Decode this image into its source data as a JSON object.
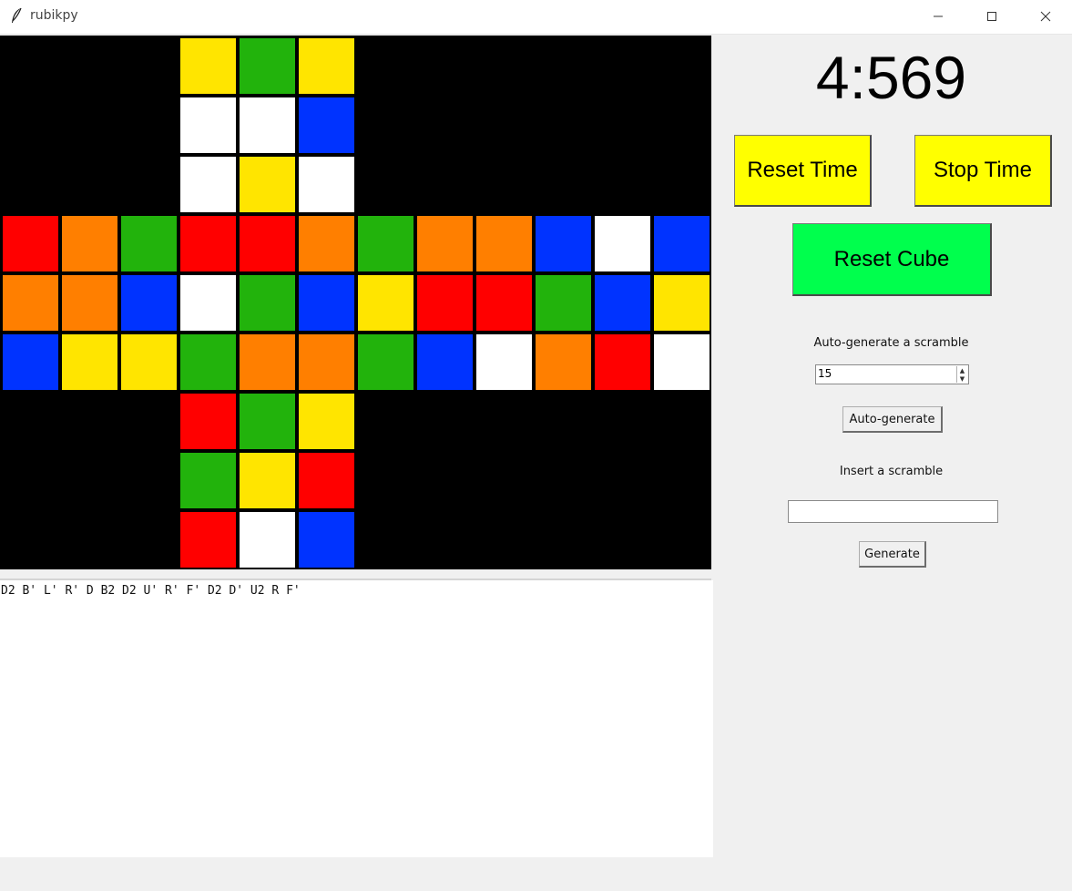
{
  "window": {
    "title": "rubikpy"
  },
  "colors": {
    "W": "#ffffff",
    "Y": "#ffe500",
    "G": "#22b30c",
    "B": "#0033ff",
    "R": "#ff0000",
    "O": "#ff7f00"
  },
  "cube": {
    "up": [
      [
        "Y",
        "G",
        "Y"
      ],
      [
        "W",
        "W",
        "B"
      ],
      [
        "W",
        "Y",
        "W"
      ]
    ],
    "left": [
      [
        "R",
        "O",
        "G"
      ],
      [
        "O",
        "O",
        "B"
      ],
      [
        "B",
        "Y",
        "Y"
      ]
    ],
    "front": [
      [
        "R",
        "R",
        "O"
      ],
      [
        "W",
        "G",
        "B"
      ],
      [
        "G",
        "O",
        "O"
      ]
    ],
    "right": [
      [
        "G",
        "O",
        "O"
      ],
      [
        "Y",
        "R",
        "R"
      ],
      [
        "G",
        "B",
        "W"
      ]
    ],
    "back": [
      [
        "B",
        "W",
        "B"
      ],
      [
        "G",
        "B",
        "Y"
      ],
      [
        "O",
        "R",
        "W"
      ]
    ],
    "down": [
      [
        "R",
        "G",
        "Y"
      ],
      [
        "G",
        "Y",
        "R"
      ],
      [
        "R",
        "W",
        "B"
      ]
    ]
  },
  "scramble_text": "D2 B' L' R' D B2 D2 U' R' F' D2 D' U2 R F'",
  "timer": "4:569",
  "buttons": {
    "reset_time": "Reset Time",
    "stop_time": "Stop Time",
    "reset_cube": "Reset Cube",
    "auto_generate": "Auto-generate",
    "generate": "Generate"
  },
  "auto_generate_label": "Auto-generate a scramble",
  "scramble_length": "15",
  "insert_label": "Insert a scramble",
  "insert_value": ""
}
